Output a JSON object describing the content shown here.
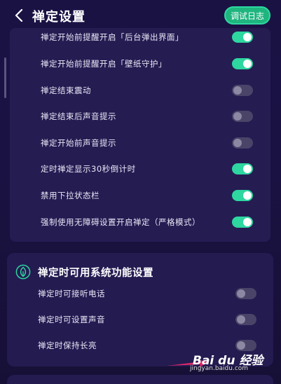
{
  "header": {
    "title": "禅定设置",
    "debug_label": "调试日志"
  },
  "settings_main": [
    {
      "label": "禅定开始前提醒开启「后台弹出界面」",
      "on": true
    },
    {
      "label": "禅定开始前提醒开启「壁纸守护」",
      "on": true
    },
    {
      "label": "禅定结束震动",
      "on": false
    },
    {
      "label": "禅定结束后声音提示",
      "on": false
    },
    {
      "label": "禅定开始前声音提示",
      "on": false
    },
    {
      "label": "定时禅定显示30秒倒计时",
      "on": true
    },
    {
      "label": "禁用下拉状态栏",
      "on": true
    },
    {
      "label": "强制使用无障碍设置开启禅定（严格模式）",
      "on": true
    }
  ],
  "system_section": {
    "title": "禅定时可用系统功能设置",
    "items": [
      {
        "label": "禅定时可接听电话",
        "on": false
      },
      {
        "label": "禅定时可设置声音",
        "on": false
      },
      {
        "label": "禅定时保持长亮",
        "on": false
      }
    ]
  },
  "watermark": {
    "logo": "Bai du 经验",
    "url": "jingyan.baidu.com"
  },
  "colors": {
    "accent": "#2ed6a0",
    "background": "#1a1140",
    "card": "#251c52"
  },
  "icons": {
    "back": "chevron-left-icon",
    "leaf": "leaf-icon"
  }
}
